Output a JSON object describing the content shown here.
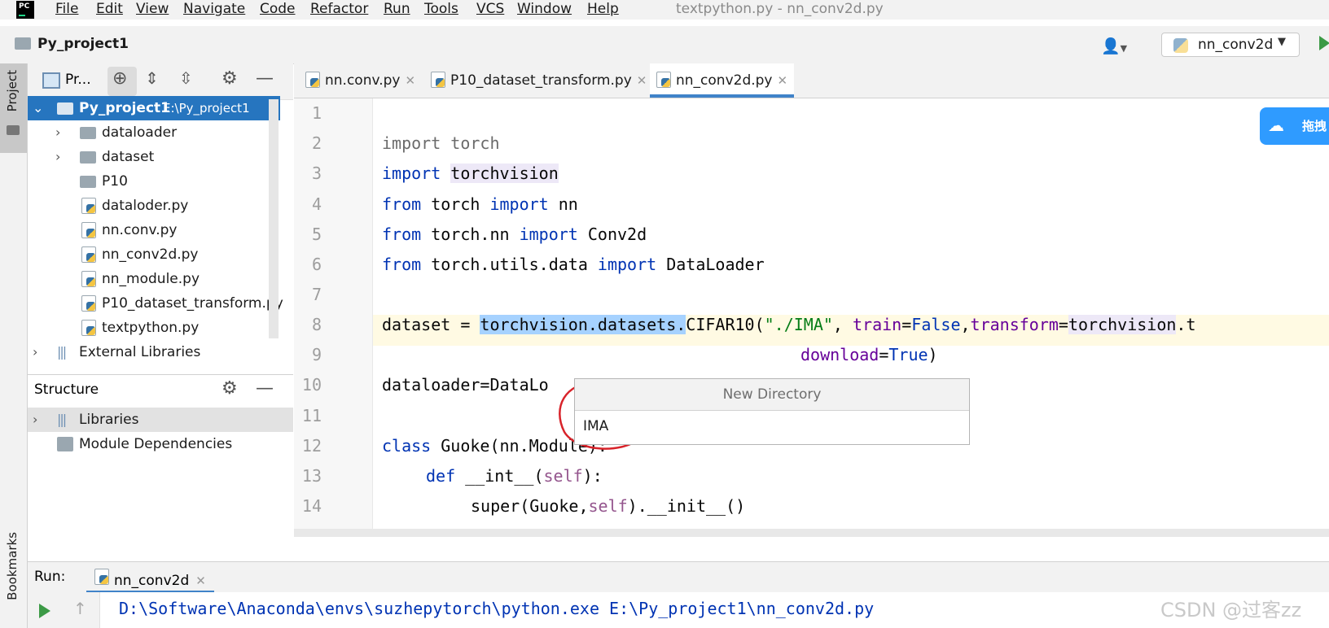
{
  "menu": [
    "File",
    "Edit",
    "View",
    "Navigate",
    "Code",
    "Refactor",
    "Run",
    "Tools",
    "VCS",
    "Window",
    "Help"
  ],
  "window_title": "textpython.py - nn_conv2d.py",
  "breadcrumb": "Py_project1",
  "run_config": "nn_conv2d",
  "left_strip": {
    "project": "Project",
    "bookmarks": "Bookmarks"
  },
  "project_panel": {
    "title": "Pr...",
    "tree": [
      {
        "label": "Py_project1",
        "path": "E:\\Py_project1",
        "selected": true
      },
      {
        "label": "dataloader"
      },
      {
        "label": "dataset"
      },
      {
        "label": "P10"
      },
      {
        "label": "dataloder.py"
      },
      {
        "label": "nn.conv.py"
      },
      {
        "label": "nn_conv2d.py"
      },
      {
        "label": "nn_module.py"
      },
      {
        "label": "P10_dataset_transform.py"
      },
      {
        "label": "textpython.py"
      },
      {
        "label": "External Libraries"
      }
    ]
  },
  "structure_panel": {
    "title": "Structure",
    "items": [
      "Libraries",
      "Module Dependencies"
    ]
  },
  "tabs": [
    "nn.conv.py",
    "P10_dataset_transform.py",
    "nn_conv2d.py"
  ],
  "line_numbers": [
    "1",
    "2",
    "3",
    "4",
    "5",
    "6",
    "7",
    "8",
    "9",
    "10",
    "11",
    "12",
    "13",
    "14"
  ],
  "code": {
    "l2": [
      "import",
      " torch"
    ],
    "l3": [
      "import",
      " ",
      "torchvision"
    ],
    "l4": [
      "from",
      " torch ",
      "import",
      " nn"
    ],
    "l5": [
      "from",
      " torch.nn ",
      "import",
      " Conv2d"
    ],
    "l6": [
      "from",
      " torch.utils.data ",
      "import",
      " DataLoader"
    ],
    "l8": [
      "dataset = ",
      "torchvision.datasets.",
      "CIFAR10(",
      "\"./IMA\"",
      ", ",
      "train",
      "=",
      "False",
      ",",
      "transform",
      "=",
      "torchvision",
      ".t"
    ],
    "l9": [
      "download",
      "=",
      "True",
      ")"
    ],
    "l10": "dataloader=DataLo",
    "l12": [
      "class",
      " Guoke(nn.Module):"
    ],
    "l13": [
      "def",
      " __int__(",
      "self",
      "):"
    ],
    "l14": [
      "super(Guoke,",
      "self",
      ").__init__()"
    ]
  },
  "popup": {
    "title": "New Directory",
    "value": "IMA"
  },
  "badge": "拖拽",
  "run_panel": {
    "label": "Run:",
    "tab": "nn_conv2d",
    "console": "D:\\Software\\Anaconda\\envs\\suzhepytorch\\python.exe E:\\Py_project1\\nn_conv2d.py"
  },
  "watermark": "CSDN @过客zz",
  "colors": {
    "selection": "#2675bf",
    "keyword": "#0033b3",
    "string": "#067d17",
    "param": "#660099",
    "accent": "#4083c9"
  }
}
